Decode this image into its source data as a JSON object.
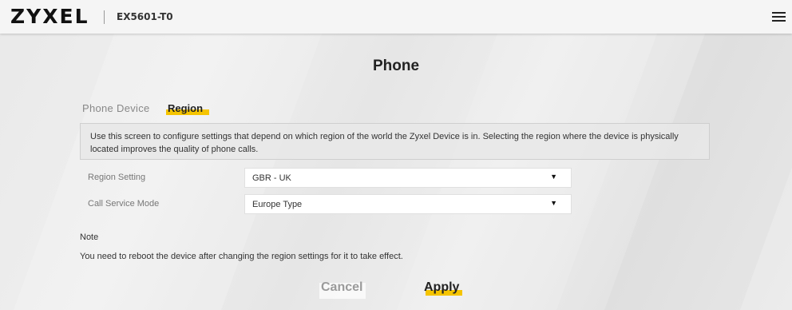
{
  "header": {
    "brand": "ZYXEL",
    "model": "EX5601-T0"
  },
  "page": {
    "title": "Phone"
  },
  "tabs": [
    {
      "label": "Phone Device",
      "active": false
    },
    {
      "label": "Region",
      "active": true
    }
  ],
  "info": {
    "text": "Use this screen to configure settings that depend on which region of the world the Zyxel Device is in. Selecting the region where the device is physically located improves the quality of phone calls."
  },
  "form": {
    "region_setting": {
      "label": "Region Setting",
      "value": "GBR - UK"
    },
    "call_service_mode": {
      "label": "Call Service Mode",
      "value": "Europe Type"
    }
  },
  "note": {
    "title": "Note",
    "text": "You need to reboot the device after changing the region settings for it to take effect."
  },
  "actions": {
    "cancel_label": "Cancel",
    "apply_label": "Apply"
  },
  "icons": {
    "menu": "hamburger-menu-icon",
    "dropdown": "chevron-down-icon"
  },
  "colors": {
    "accent": "#f5c400"
  }
}
